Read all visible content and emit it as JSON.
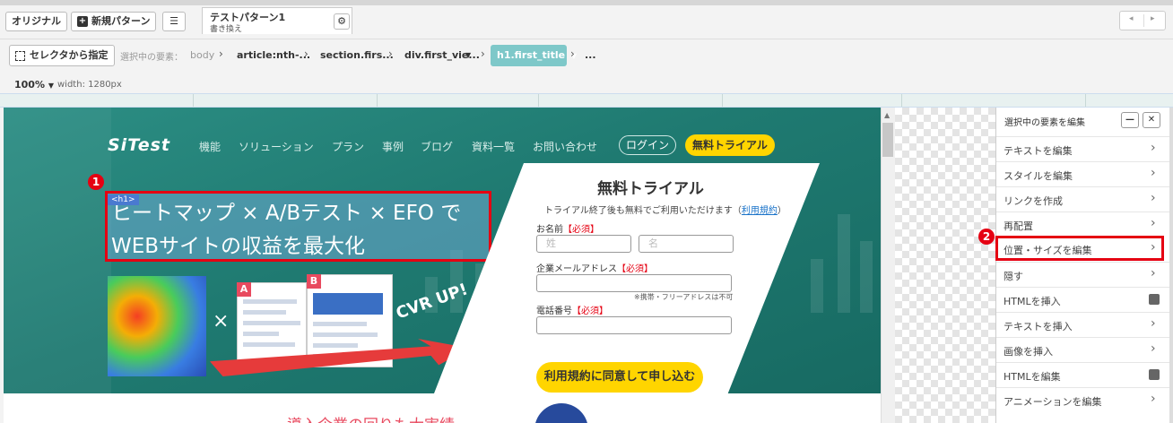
{
  "toolbar": {
    "original_label": "オリジナル",
    "new_pattern_label": "新規パターン",
    "list_icon": "list-icon",
    "pattern_tab": {
      "name": "テストパターン1",
      "sub": "書き換え"
    },
    "settings_icon": "gear-icon",
    "nav_prev": "◂",
    "nav_next": "▸"
  },
  "selector_bar": {
    "select_button": "セレクタから指定",
    "selected_label": "選択中の要素：",
    "crumbs": [
      "body",
      "article:nth-...",
      "section.firs...",
      "div.first_vie...",
      "h1.first_title",
      "..."
    ]
  },
  "viewport": {
    "zoom": "100%",
    "width_label": "width: 1280px"
  },
  "site": {
    "logo": "SiTest",
    "nav": [
      "機能",
      "ソリューション",
      "プラン",
      "事例",
      "ブログ",
      "資料一覧",
      "お問い合わせ"
    ],
    "login": "ログイン",
    "trial": "無料トライアル",
    "h1_tag": "<h1>",
    "headline_line1": "ヒートマップ × A/Bテスト × EFO で",
    "headline_line2": "WEBサイトの収益を最大化",
    "times": "×",
    "ab_a": "A",
    "ab_b": "B",
    "cvr": "CVR UP!",
    "below_text": "導入企業の回りも大実績"
  },
  "form": {
    "title": "無料トライアル",
    "subtitle_pre": "トライアル終了後も無料でご利用いただけます（",
    "subtitle_link": "利用規約",
    "subtitle_post": "）",
    "name_label": "お名前",
    "required": "【必須】",
    "last_name_placeholder": "姓",
    "first_name_placeholder": "名",
    "email_label": "企業メールアドレス",
    "email_note": "※携帯・フリーアドレスは不可",
    "phone_label": "電話番号",
    "submit": "利用規約に同意して申し込む"
  },
  "panel": {
    "title": "選択中の要素を編集",
    "items": [
      {
        "label": "テキストを編集",
        "icon": "chevron-right-icon"
      },
      {
        "label": "スタイルを編集",
        "icon": "chevron-right-icon"
      },
      {
        "label": "リンクを作成",
        "icon": "chevron-right-icon"
      },
      {
        "label": "再配置",
        "icon": "chevron-right-icon"
      },
      {
        "label": "位置・サイズを編集",
        "icon": "chevron-right-icon",
        "highlighted": true
      },
      {
        "label": "隠す",
        "icon": "chevron-right-icon"
      },
      {
        "label": "HTMLを挿入",
        "icon": "copy-icon"
      },
      {
        "label": "テキストを挿入",
        "icon": "chevron-right-icon"
      },
      {
        "label": "画像を挿入",
        "icon": "chevron-right-icon"
      },
      {
        "label": "HTMLを編集",
        "icon": "copy-icon"
      },
      {
        "label": "アニメーションを編集",
        "icon": "chevron-right-icon"
      }
    ]
  },
  "markers": {
    "one": "1",
    "two": "2"
  },
  "colors": {
    "accent_teal": "#7ec8c9",
    "highlight_red": "#e50012",
    "cta_yellow": "#ffd500",
    "hero_green": "#1f7a71"
  }
}
